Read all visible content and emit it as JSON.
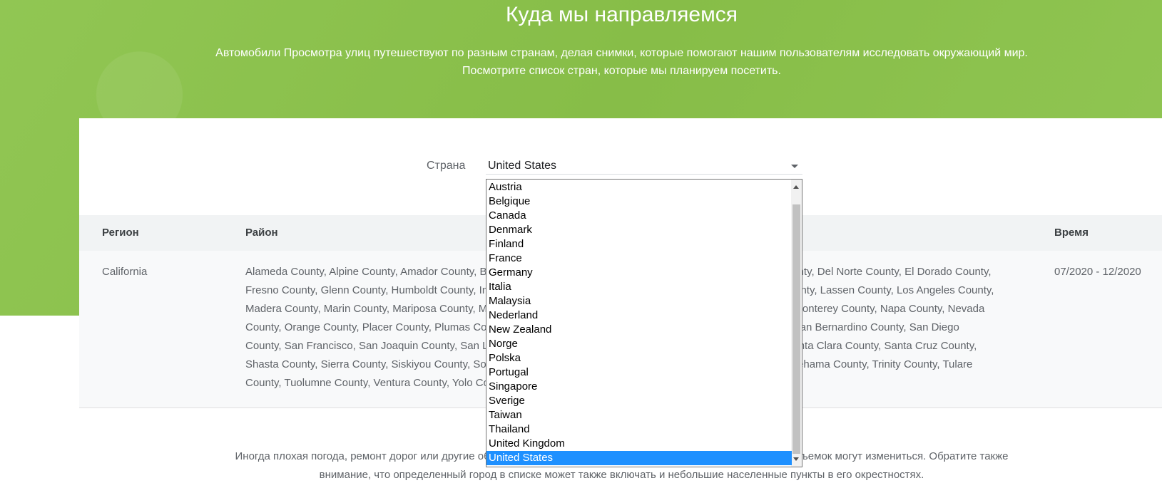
{
  "hero": {
    "title": "Куда мы направляемся",
    "subtitle": "Автомобили Просмотра улиц путешествуют по разным странам, делая снимки, которые помогают нашим пользователям исследовать окружающий мир. Посмотрите список стран, которые мы планируем посетить."
  },
  "filter": {
    "country_label": "Страна",
    "selected": "United States"
  },
  "dropdown": {
    "options": [
      "Austria",
      "Belgique",
      "Canada",
      "Denmark",
      "Finland",
      "France",
      "Germany",
      "Italia",
      "Malaysia",
      "Nederland",
      "New Zealand",
      "Norge",
      "Polska",
      "Portugal",
      "Singapore",
      "Sverige",
      "Taiwan",
      "Thailand",
      "United Kingdom",
      "United States"
    ],
    "selected_index": 19
  },
  "table": {
    "headers": {
      "region": "Регион",
      "district": "Район",
      "time": "Время"
    },
    "rows": [
      {
        "region": "California",
        "districts": "Alameda County, Alpine County, Amador County, Butte County, Calaveras County, Colusa County, Contra Costa County, Del Norte County, El Dorado County, Fresno County, Glenn County, Humboldt County, Imperial County, Inyo County, Kern County, Kings County, Lake County, Lassen County, Los Angeles County, Madera County, Marin County, Mariposa County, Mendocino County, Merced County, Modoc County, Mono County, Monterey County, Napa County, Nevada County, Orange County, Placer County, Plumas County, Riverside County, Sacramento County, San Benito County, San Bernardino County, San Diego County, San Francisco, San Joaquin County, San Luis Obispo County, San Mateo County, Santa Barbara County, Santa Clara County, Santa Cruz County, Shasta County, Sierra County, Siskiyou County, Solano County, Sonoma County, Stanislaus County, Sutter County, Tehama County, Trinity County, Tulare County, Tuolumne County, Ventura County, Yolo County, Yuba County",
        "time": "07/2020 - 12/2020"
      }
    ]
  },
  "footer": {
    "note": "Иногда плохая погода, ремонт дорог или другие обстоятельства могут помешать нашим планам, поэтому сроки съемок могут измениться. Обратите также внимание, что определенный город в списке может также включать и небольшие населенные пункты в его окрестностях."
  },
  "colors": {
    "hero_green": "#8bc34a",
    "selected_option": "#1e90ff"
  }
}
